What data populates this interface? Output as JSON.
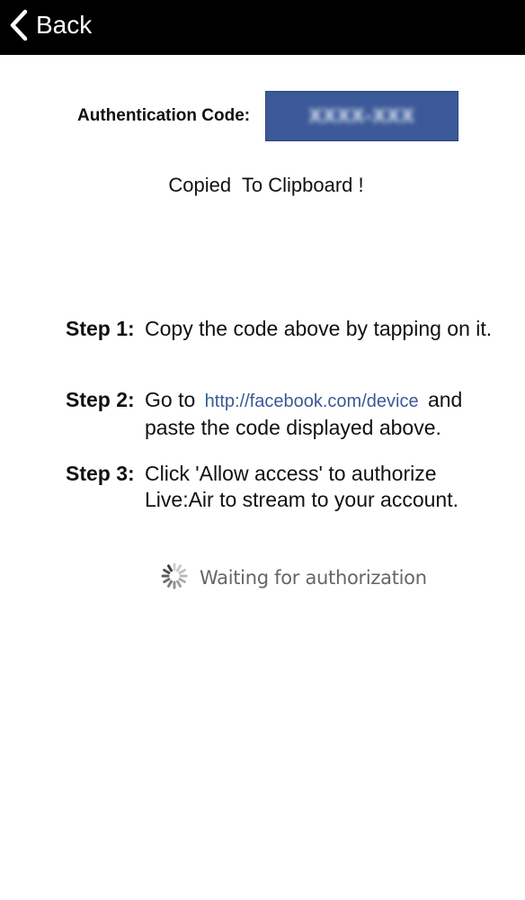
{
  "nav": {
    "back_label": "Back"
  },
  "auth": {
    "label": "Authentication Code:",
    "code": "XXXX-XXX"
  },
  "status": {
    "copied": "Copied  To Clipboard !",
    "waiting": "Waiting for authorization"
  },
  "steps": [
    {
      "label": "Step 1:",
      "text": "Copy the code above by tapping on it."
    },
    {
      "label": "Step 2:",
      "before": "Go to",
      "link": "http://facebook.com/device",
      "after": "and paste the code displayed above."
    },
    {
      "label": "Step 3:",
      "text": "Click 'Allow access' to authorize Live:Air to stream to your account."
    }
  ],
  "colors": {
    "navbar": "#000000",
    "code_box": "#3b5998",
    "link": "#3b5998"
  },
  "icons": {
    "back": "chevron-left-icon",
    "spinner": "spinner-icon"
  }
}
